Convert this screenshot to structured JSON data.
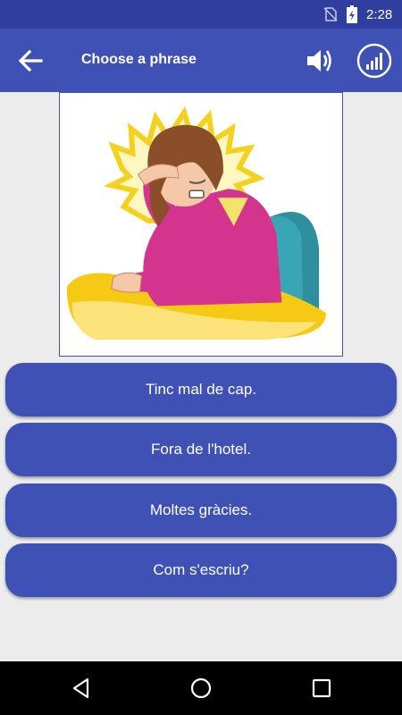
{
  "status_bar": {
    "time": "2:28"
  },
  "app_bar": {
    "title": "Choose a phrase",
    "back_icon": "arrow-left-icon",
    "speaker_icon": "volume-up-icon",
    "stats_icon": "bar-chart-icon"
  },
  "illustration": {
    "subject": "woman-with-headache"
  },
  "options": [
    {
      "label": "Tinc mal de cap."
    },
    {
      "label": "Fora de l'hotel."
    },
    {
      "label": "Moltes gràcies."
    },
    {
      "label": "Com s'escriu?"
    }
  ],
  "nav_bar": {
    "back_icon": "triangle-back-icon",
    "home_icon": "circle-home-icon",
    "recents_icon": "square-recents-icon"
  },
  "colors": {
    "primary": "#3f51b5",
    "primary_dark": "#303f9f",
    "background": "#ececec"
  }
}
